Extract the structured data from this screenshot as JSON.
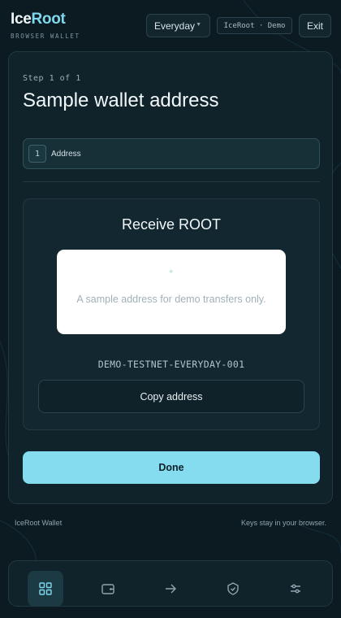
{
  "header": {
    "logo_part1": "Ice",
    "logo_part2": "Root",
    "subtitle": "BROWSER WALLET",
    "profile_select": "Everyday",
    "mode_chip": "IceRoot · Demo",
    "exit_label": "Exit"
  },
  "card": {
    "step_label": "Step 1 of 1",
    "title": "Sample wallet address",
    "stepper": {
      "number": "1",
      "label": "Address"
    },
    "receive": {
      "title": "Receive ROOT",
      "placeholder_text": "A sample address for demo transfers only.",
      "address": "DEMO-TESTNET-EVERYDAY-001",
      "copy_label": "Copy address"
    },
    "done_label": "Done"
  },
  "footer": {
    "left": "IceRoot Wallet",
    "right": "Keys stay in your browser."
  },
  "nav": {
    "items": [
      {
        "icon": "grid-icon",
        "active": true
      },
      {
        "icon": "wallet-icon",
        "active": false
      },
      {
        "icon": "arrow-right-icon",
        "active": false
      },
      {
        "icon": "shield-check-icon",
        "active": false
      },
      {
        "icon": "sliders-icon",
        "active": false
      }
    ]
  },
  "colors": {
    "accent": "#86dcef",
    "background": "#0c1b22",
    "card": "#10232b"
  }
}
